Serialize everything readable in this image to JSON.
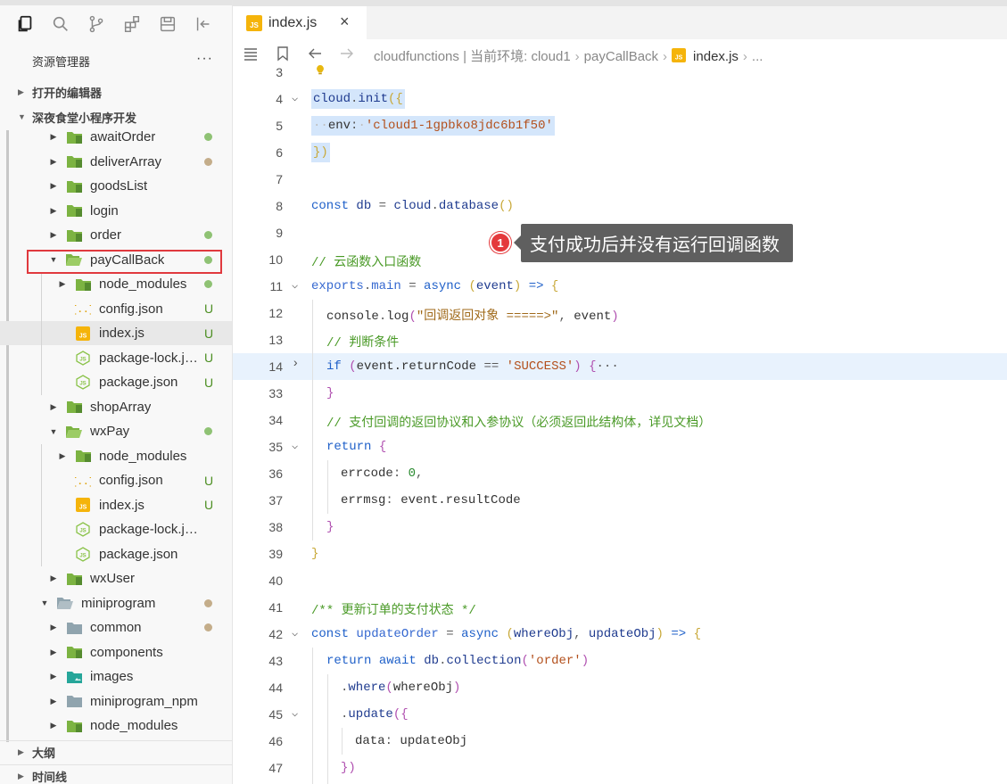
{
  "sidebar": {
    "explorer_title": "资源管理器",
    "more_label": "···",
    "sections": {
      "open_editors": "打开的编辑器",
      "project": "深夜食堂小程序开发",
      "outline": "大纲",
      "timeline": "时间线"
    },
    "tree": [
      {
        "label": "awaitOrder",
        "status": "dot-green"
      },
      {
        "label": "deliverArray",
        "status": "dot-tan"
      },
      {
        "label": "goodsList",
        "status": ""
      },
      {
        "label": "login",
        "status": ""
      },
      {
        "label": "order",
        "status": "dot-green"
      },
      {
        "label": "payCallBack",
        "status": "dot-green"
      },
      {
        "label": "node_modules",
        "status": "dot-green"
      },
      {
        "label": "config.json",
        "status": "U"
      },
      {
        "label": "index.js",
        "status": "U"
      },
      {
        "label": "package-lock.js...",
        "status": "U"
      },
      {
        "label": "package.json",
        "status": "U"
      },
      {
        "label": "shopArray",
        "status": ""
      },
      {
        "label": "wxPay",
        "status": "dot-green"
      },
      {
        "label": "node_modules",
        "status": ""
      },
      {
        "label": "config.json",
        "status": "U"
      },
      {
        "label": "index.js",
        "status": "U"
      },
      {
        "label": "package-lock.json",
        "status": ""
      },
      {
        "label": "package.json",
        "status": ""
      },
      {
        "label": "wxUser",
        "status": ""
      },
      {
        "label": "miniprogram",
        "status": "dot-tan"
      },
      {
        "label": "common",
        "status": "dot-tan"
      },
      {
        "label": "components",
        "status": ""
      },
      {
        "label": "images",
        "status": ""
      },
      {
        "label": "miniprogram_npm",
        "status": ""
      },
      {
        "label": "node_modules",
        "status": ""
      }
    ]
  },
  "tab": {
    "label": "index.js",
    "icon": "js-file-icon",
    "close": "×"
  },
  "breadcrumb": {
    "seg1": "cloudfunctions | 当前环境: cloud1",
    "seg2": "payCallBack",
    "seg3": "index.js",
    "seg4": "...",
    "badge": "JS",
    "sep": "›"
  },
  "code": {
    "line_numbers": [
      "3",
      "4",
      "5",
      "6",
      "7",
      "8",
      "9",
      "10",
      "11",
      "12",
      "13",
      "14",
      "33",
      "34",
      "35",
      "36",
      "37",
      "38",
      "39",
      "40",
      "41",
      "42",
      "43",
      "44",
      "45",
      "46",
      "47"
    ],
    "l4": {
      "obj": "cloud",
      "dot": ".",
      "fn": "init",
      "open": "({"
    },
    "l5": {
      "key": "env",
      "colon": ":",
      "val": "'cloud1-1gpbko8jdc6b1f50'"
    },
    "l6": {
      "close": "})"
    },
    "l8": {
      "kw": "const",
      "id": "db",
      "eq": "=",
      "obj": "cloud",
      "dot": ".",
      "fn": "database",
      "parens": "()"
    },
    "l10": {
      "comment": "// 云函数入口函数"
    },
    "l11": {
      "obj": "exports",
      "dot": ".",
      "fn": "main",
      "eq": "=",
      "kw": "async",
      "p1": "(",
      "arg": "event",
      "p2": ")",
      "arrow": "=>",
      "brace": "{"
    },
    "l12": {
      "obj": "console",
      "dot": ".",
      "fn": "log",
      "p1": "(",
      "str": "\"回调返回对象 =====>\"",
      "comma": ",",
      "arg": "event",
      "p2": ")"
    },
    "l13": {
      "comment": "// 判断条件"
    },
    "l14": {
      "kw": "if",
      "p1": "(",
      "expr": "event.returnCode",
      "op": "==",
      "str": "'SUCCESS'",
      "p2": ")",
      "brace": "{",
      "ellipsis": "···"
    },
    "l33": {
      "brace": "}"
    },
    "l34": {
      "comment": "// 支付回调的返回协议和入参协议（必须返回此结构体，详见文档）"
    },
    "l35": {
      "kw": "return",
      "brace": "{"
    },
    "l36": {
      "key": "errcode",
      "colon": ":",
      "num": "0",
      "comma": ","
    },
    "l37": {
      "key": "errmsg",
      "colon": ":",
      "val": "event.resultCode"
    },
    "l38": {
      "brace": "}"
    },
    "l39": {
      "brace": "}"
    },
    "l41": {
      "comment": "/** 更新订单的支付状态 */"
    },
    "l42": {
      "kw": "const",
      "fn": "updateOrder",
      "eq": "=",
      "kw2": "async",
      "p1": "(",
      "arg1": "whereObj",
      "comma": ",",
      "arg2": "updateObj",
      "p2": ")",
      "arrow": "=>",
      "brace": "{"
    },
    "l43": {
      "kw": "return",
      "kw2": "await",
      "obj": "db",
      "dot": ".",
      "fn": "collection",
      "p1": "(",
      "str": "'order'",
      "p2": ")"
    },
    "l44": {
      "dot": ".",
      "fn": "where",
      "p1": "(",
      "arg": "whereObj",
      "p2": ")"
    },
    "l45": {
      "dot": ".",
      "fn": "update",
      "open": "({"
    },
    "l46": {
      "key": "data",
      "colon": ":",
      "val": "updateObj"
    },
    "l47": {
      "close": "})"
    }
  },
  "annotation": {
    "number": "1",
    "text": "支付成功后并没有运行回调函数"
  }
}
